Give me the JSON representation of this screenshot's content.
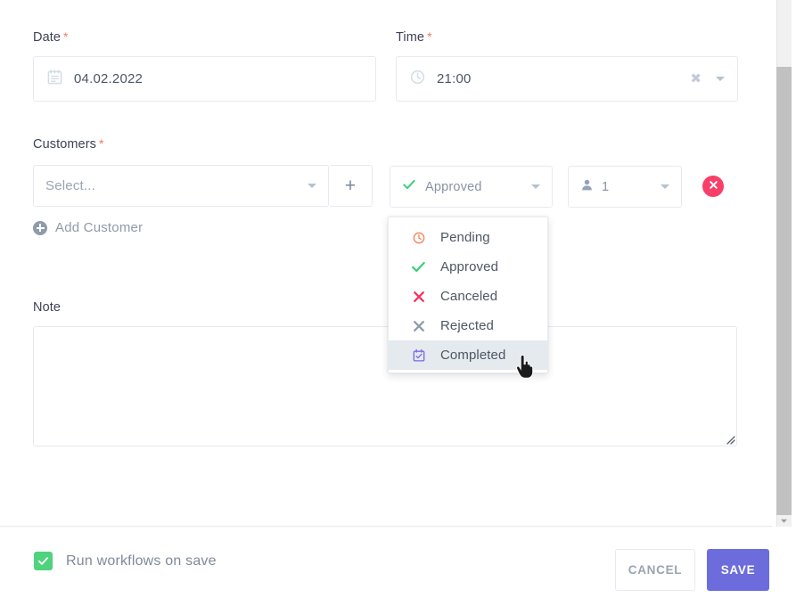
{
  "form": {
    "date": {
      "label": "Date",
      "required_marker": "*",
      "value": "04.02.2022",
      "icon": "calendar-icon"
    },
    "time": {
      "label": "Time",
      "required_marker": "*",
      "value": "21:00",
      "icon": "clock-icon",
      "clear_glyph": "✖"
    },
    "customers": {
      "label": "Customers",
      "required_marker": "*",
      "select_placeholder": "Select...",
      "add_button_glyph": "+",
      "status_value": "Approved",
      "count_value": "1",
      "remove_glyph": "✖",
      "add_customer_label": "Add Customer"
    },
    "note": {
      "label": "Note",
      "value": "",
      "placeholder": ""
    }
  },
  "status_menu": {
    "items": [
      {
        "label": "Pending",
        "icon": "clock-icon",
        "color": "#f5835c",
        "active": false
      },
      {
        "label": "Approved",
        "icon": "check-icon",
        "color": "#3fd07a",
        "active": false
      },
      {
        "label": "Canceled",
        "icon": "cross-icon",
        "color": "#f7305f",
        "active": false
      },
      {
        "label": "Rejected",
        "icon": "x-icon",
        "color": "#8e9aa8",
        "active": false
      },
      {
        "label": "Completed",
        "icon": "calendar-check-icon",
        "color": "#7b68e8",
        "active": true
      }
    ]
  },
  "footer": {
    "run_workflows_label": "Run workflows on save",
    "run_workflows_checked": true,
    "cancel_label": "CANCEL",
    "save_label": "SAVE"
  },
  "colors": {
    "accent_purple": "#6c6cdc",
    "danger_pink": "#f73f69",
    "success_green": "#4fd37d",
    "required_orange": "#f5795b",
    "border": "#e6eaf0"
  }
}
